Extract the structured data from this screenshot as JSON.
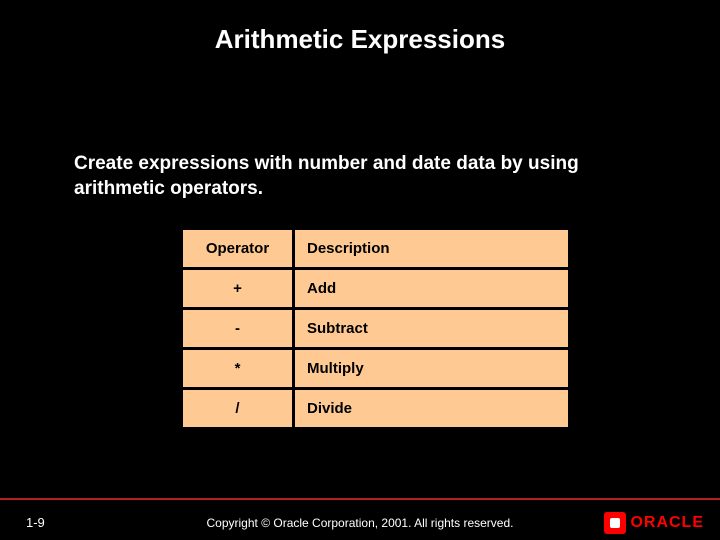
{
  "title": "Arithmetic Expressions",
  "body": "Create expressions with number and date data by using arithmetic operators.",
  "table": {
    "header": {
      "operator": "Operator",
      "description": "Description"
    },
    "rows": [
      {
        "operator": "+",
        "description": "Add"
      },
      {
        "operator": "-",
        "description": "Subtract"
      },
      {
        "operator": "*",
        "description": "Multiply"
      },
      {
        "operator": "/",
        "description": "Divide"
      }
    ]
  },
  "footer": {
    "page": "1-9",
    "copyright": "Copyright © Oracle Corporation, 2001. All rights reserved.",
    "logo_text": "ORACLE"
  }
}
